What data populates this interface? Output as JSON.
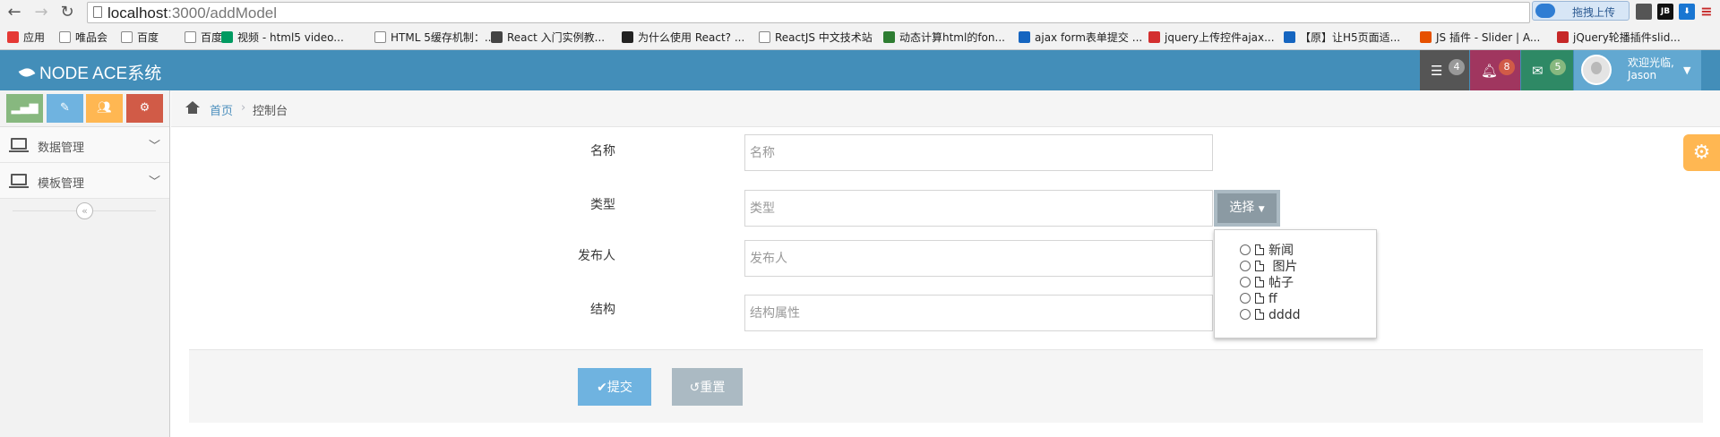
{
  "browser": {
    "url_host": "localhost",
    "url_rest": ":3000/addModel",
    "upload_label": "拖拽上传",
    "ext_jb": "JB",
    "bookmarks": [
      {
        "label": "应用",
        "color": "#e53935"
      },
      {
        "label": "唯品会",
        "color": "doc"
      },
      {
        "label": "百度",
        "color": "doc"
      },
      {
        "label": "百度",
        "color": "doc"
      },
      {
        "label": "视频 - html5 video...",
        "color": "#009a61"
      },
      {
        "label": "HTML 5缓存机制：...",
        "color": "doc"
      },
      {
        "label": "React 入门实例教...",
        "color": "#444"
      },
      {
        "label": "为什么使用 React? ...",
        "color": "#222"
      },
      {
        "label": "ReactJS 中文技术站",
        "color": "doc"
      },
      {
        "label": "动态计算html的fon...",
        "color": "#2e7d32"
      },
      {
        "label": "ajax form表单提交 ...",
        "color": "#1565c0"
      },
      {
        "label": "jquery上传控件ajax...",
        "color": "#d32f2f"
      },
      {
        "label": "【原】让H5页面适...",
        "color": "#1565c0"
      },
      {
        "label": "JS 插件 - Slider | A...",
        "color": "#e65100"
      },
      {
        "label": "jQuery轮播插件slid...",
        "color": "#c62828"
      }
    ]
  },
  "navbar": {
    "brand": "NODE ACE系统",
    "tasks_count": "4",
    "notifications_count": "8",
    "messages_count": "5",
    "welcome_line1": "欢迎光临,",
    "welcome_line2": "Jason"
  },
  "sidebar": {
    "items": [
      {
        "label": "数据管理"
      },
      {
        "label": "模板管理"
      }
    ]
  },
  "breadcrumb": {
    "home": "首页",
    "current": "控制台"
  },
  "form": {
    "name_label": "名称",
    "name_placeholder": "名称",
    "type_label": "类型",
    "type_placeholder": "类型",
    "choose_button": "选择",
    "publisher_label": "发布人",
    "publisher_placeholder": "发布人",
    "structure_label": "结构",
    "structure_placeholder": "结构属性",
    "type_options": [
      "新闻",
      " 图片",
      "帖子",
      "ff",
      "dddd"
    ],
    "submit_label": "提交",
    "reset_label": "重置"
  },
  "colors": {
    "navbar": "#438eb9",
    "tasks": "#555555",
    "notifications": "#a0365f",
    "messages": "#2e8965",
    "user": "#62a8d1",
    "submit": "#6fb3e0",
    "reset": "#abbac3",
    "settings": "#ffb752"
  }
}
